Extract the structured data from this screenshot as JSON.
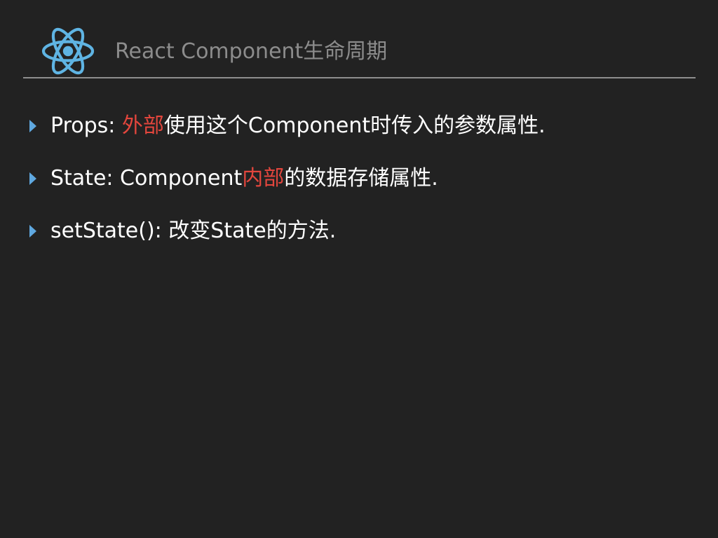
{
  "header": {
    "logo_icon": "react-atom-icon",
    "title": "React Component生命周期"
  },
  "bullets": [
    {
      "lead": "Props: ",
      "highlight": "外部",
      "rest": "使用这个Component时传入的参数属性."
    },
    {
      "lead": "State: Component",
      "highlight": "内部",
      "rest": "的数据存储属性."
    },
    {
      "lead": "setState(): 改变State的方法."
    }
  ],
  "colors": {
    "background": "#222222",
    "title": "#8c8c8c",
    "text": "#ffffff",
    "highlight": "#e3463d",
    "accent": "#5fa8e0",
    "rule": "#8e8e8e"
  }
}
